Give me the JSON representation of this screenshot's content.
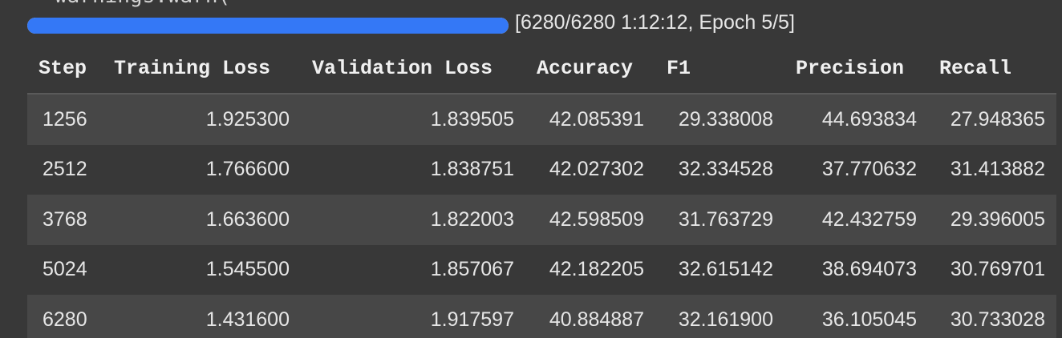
{
  "warning_line": "warnings.warn(",
  "progress": {
    "fraction": 1.0,
    "text": "[6280/6280 1:12:12, Epoch 5/5]",
    "bar_color": "#3478f6"
  },
  "table": {
    "columns": [
      "Step",
      "Training Loss",
      "Validation Loss",
      "Accuracy",
      "F1",
      "Precision",
      "Recall"
    ],
    "rows": [
      [
        "1256",
        "1.925300",
        "1.839505",
        "42.085391",
        "29.338008",
        "44.693834",
        "27.948365"
      ],
      [
        "2512",
        "1.766600",
        "1.838751",
        "42.027302",
        "32.334528",
        "37.770632",
        "31.413882"
      ],
      [
        "3768",
        "1.663600",
        "1.822003",
        "42.598509",
        "31.763729",
        "42.432759",
        "29.396005"
      ],
      [
        "5024",
        "1.545500",
        "1.857067",
        "42.182205",
        "32.615142",
        "38.694073",
        "30.769701"
      ],
      [
        "6280",
        "1.431600",
        "1.917597",
        "40.884887",
        "32.161900",
        "36.105045",
        "30.733028"
      ]
    ]
  }
}
